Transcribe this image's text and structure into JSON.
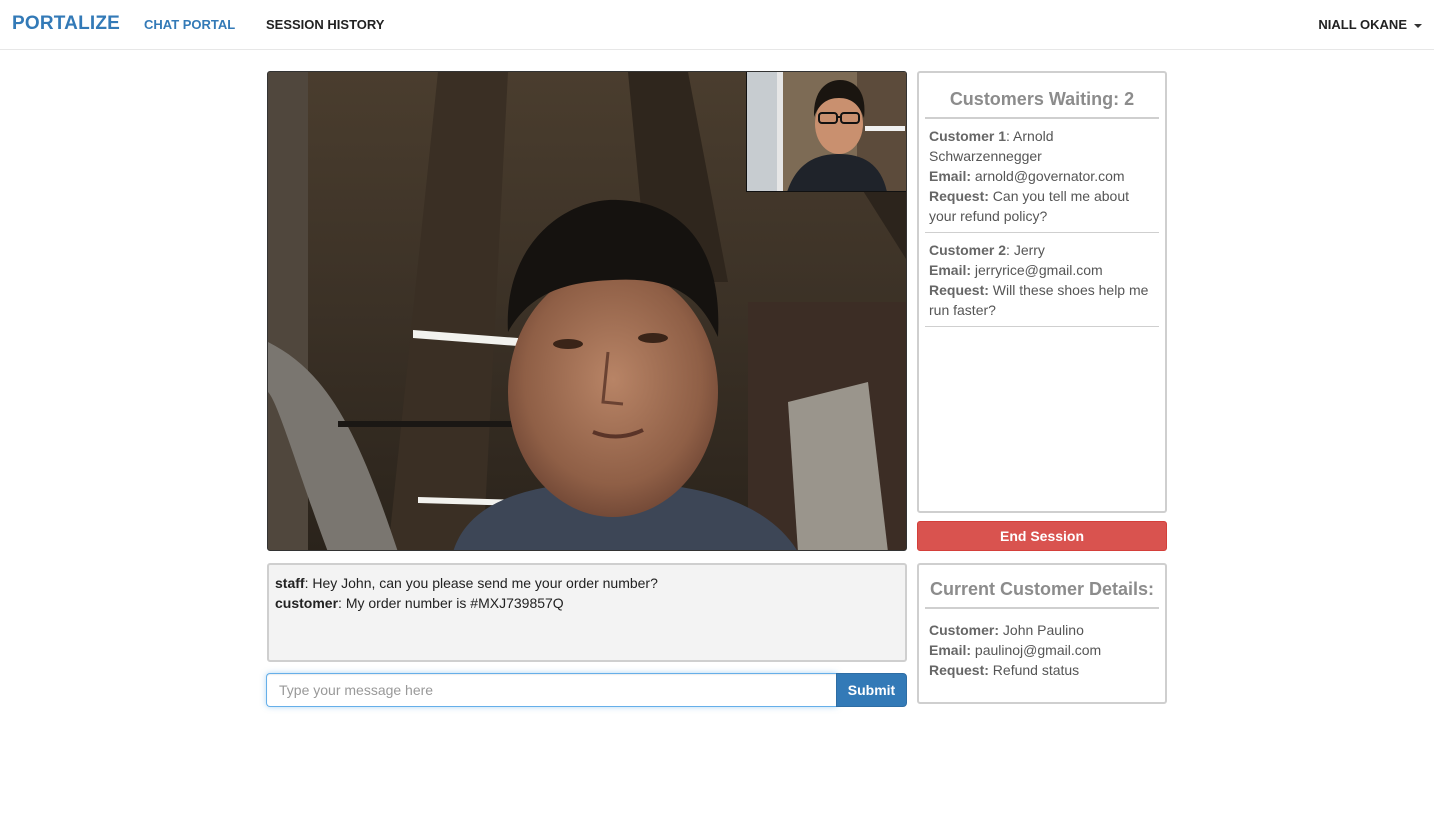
{
  "nav": {
    "brand": "PORTALIZE",
    "links": [
      "CHAT PORTAL",
      "SESSION HISTORY"
    ],
    "user": "NIALL OKANE"
  },
  "waiting": {
    "title": "Customers Waiting: 2",
    "customers": [
      {
        "label": "Customer 1",
        "name": "Arnold Schwarzennegger",
        "email_label": "Email:",
        "email": "arnold@governator.com",
        "request_label": "Request:",
        "request": "Can you tell me about your refund policy?"
      },
      {
        "label": "Customer 2",
        "name": "Jerry",
        "email_label": "Email:",
        "email": "jerryrice@gmail.com",
        "request_label": "Request:",
        "request": "Will these shoes help me run faster?"
      }
    ]
  },
  "end_session": "End Session",
  "chat": {
    "messages": [
      {
        "sender": "staff",
        "text": "Hey John, can you please send me your order number?"
      },
      {
        "sender": "customer",
        "text": "My order number is #MXJ739857Q"
      }
    ],
    "placeholder": "Type your message here",
    "submit": "Submit"
  },
  "current": {
    "title": "Current Customer Details:",
    "customer_label": "Customer:",
    "customer": "John Paulino",
    "email_label": "Email:",
    "email": "paulinoj@gmail.com",
    "request_label": "Request:",
    "request": "Refund status"
  },
  "colors": {
    "primary": "#337ab7",
    "danger": "#d9534f"
  }
}
